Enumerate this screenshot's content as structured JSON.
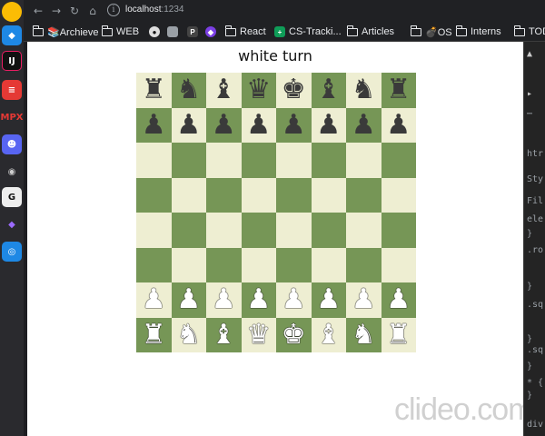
{
  "browser": {
    "url_host": "localhost",
    "url_port": ":1234",
    "bookmarks": [
      {
        "label": "📚Archieve",
        "icon": "folder-icon"
      },
      {
        "label": "WEB",
        "icon": "folder-icon"
      },
      {
        "label": "React",
        "icon": "folder-icon"
      },
      {
        "label": "CS-Tracki...",
        "icon": "sheets-icon"
      },
      {
        "label": "Articles",
        "icon": "folder-icon"
      },
      {
        "label": "💣OS",
        "icon": "folder-icon"
      },
      {
        "label": "Interns",
        "icon": "folder-icon"
      },
      {
        "label": "TOD",
        "icon": "folder-icon"
      }
    ]
  },
  "game": {
    "turn_text": "white turn",
    "light_color": "#eeeed2",
    "dark_color": "#769656",
    "board": [
      [
        "bR",
        "bN",
        "bB",
        "bQ",
        "bK",
        "bB",
        "bN",
        "bR"
      ],
      [
        "bP",
        "bP",
        "bP",
        "bP",
        "bP",
        "bP",
        "bP",
        "bP"
      ],
      [
        "",
        "",
        "",
        "",
        "",
        "",
        "",
        ""
      ],
      [
        "",
        "",
        "",
        "",
        "",
        "",
        "",
        ""
      ],
      [
        "",
        "",
        "",
        "",
        "",
        "",
        "",
        ""
      ],
      [
        "",
        "",
        "",
        "",
        "",
        "",
        "",
        ""
      ],
      [
        "wP",
        "wP",
        "wP",
        "wP",
        "wP",
        "wP",
        "wP",
        "wP"
      ],
      [
        "wR",
        "wN",
        "wB",
        "wQ",
        "wK",
        "wB",
        "wN",
        "wR"
      ]
    ]
  },
  "watermark": "clideo.com",
  "devtools": {
    "lines": [
      "htr",
      "Sty",
      "Fil",
      "ele",
      "}",
      ".ro",
      "}",
      ".sq",
      "}",
      ".sq",
      "}",
      "* {",
      "}",
      "div"
    ]
  }
}
